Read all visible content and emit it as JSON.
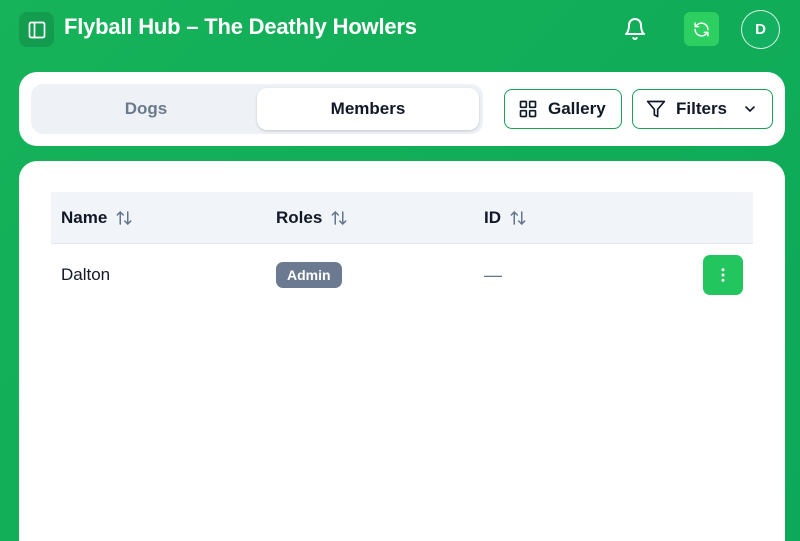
{
  "header": {
    "title": "Flyball Hub – The Deathly Howlers",
    "avatar_initial": "D",
    "icons": [
      "sidebar-toggle-icon",
      "bell-icon",
      "refresh-icon"
    ]
  },
  "toolbar": {
    "tabs": [
      {
        "label": "Dogs",
        "active": false
      },
      {
        "label": "Members",
        "active": true
      }
    ],
    "gallery_label": "Gallery",
    "filters_label": "Filters"
  },
  "table": {
    "columns": [
      {
        "label": "Name",
        "sortable": true
      },
      {
        "label": "Roles",
        "sortable": true
      },
      {
        "label": "ID",
        "sortable": true
      }
    ],
    "rows": [
      {
        "name": "Dalton",
        "role": "Admin",
        "id": "—"
      }
    ]
  },
  "colors": {
    "brand_green": "#17b35a",
    "accent_button": "#22c55e",
    "badge_gray": "#6b7a90"
  }
}
